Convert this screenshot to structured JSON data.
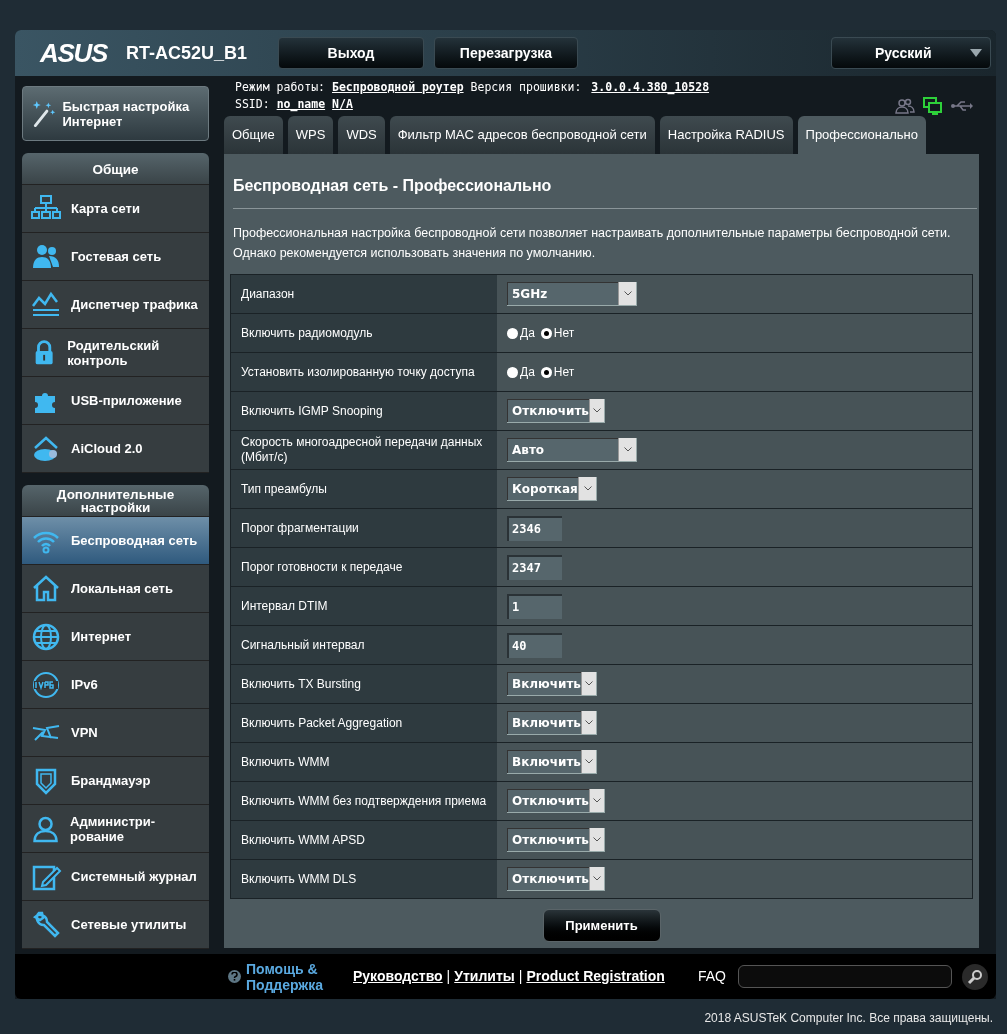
{
  "header": {
    "logo": "ASUS",
    "model": "RT-AC52U_B1",
    "buttons": [
      "Выход",
      "Перезагрузка"
    ],
    "language": "Русский"
  },
  "quick_setup": "Быстрая настройка Интернет",
  "info": {
    "mode_label": "Режим работы:",
    "mode": "Беспроводной роутер",
    "firmware_label": "Версия прошивки:",
    "firmware": "3.0.0.4.380_10528",
    "ssid_label": "SSID:",
    "ssid": [
      "no_name",
      "N/A"
    ]
  },
  "sidebar": [
    {
      "title": "Общие",
      "items": [
        {
          "label": "Карта сети",
          "selected": false
        },
        {
          "label": "Гостевая сеть",
          "selected": false
        },
        {
          "label": "Диспетчер трафика",
          "selected": false
        },
        {
          "label": "Родительский контроль",
          "selected": false
        },
        {
          "label": "USB-приложение",
          "selected": false
        },
        {
          "label": "AiCloud 2.0",
          "selected": false
        }
      ]
    },
    {
      "title": "Дополнительные настройки",
      "items": [
        {
          "label": "Беспроводная сеть",
          "selected": true
        },
        {
          "label": "Локальная сеть",
          "selected": false
        },
        {
          "label": "Интернет",
          "selected": false
        },
        {
          "label": "IPv6",
          "selected": false
        },
        {
          "label": "VPN",
          "selected": false
        },
        {
          "label": "Брандмауэр",
          "selected": false
        },
        {
          "label": "Администри-рование",
          "selected": false
        },
        {
          "label": "Системный журнал",
          "selected": false
        },
        {
          "label": "Сетевые утилиты",
          "selected": false
        }
      ]
    }
  ],
  "tabs": [
    {
      "label": "Общие",
      "selected": false
    },
    {
      "label": "WPS",
      "selected": false
    },
    {
      "label": "WDS",
      "selected": false
    },
    {
      "label": "Фильтр MAC адресов беспроводной сети",
      "selected": false
    },
    {
      "label": "Настройка RADIUS",
      "selected": false
    },
    {
      "label": "Профессионально",
      "selected": true
    }
  ],
  "page": {
    "title": "Беспроводная сеть - Профессионально",
    "description": "Профессиональная настройка беспроводной сети позволяет настраивать дополнительные параметры беспроводной сети. Однако рекомендуется использовать значения по умолчанию."
  },
  "settings": [
    {
      "label": "Диапазон",
      "kind": "select",
      "value": "5GHz"
    },
    {
      "label": "Включить радиомодуль",
      "kind": "radio",
      "options": [
        {
          "label": "Да",
          "selected": false
        },
        {
          "label": "Нет",
          "selected": true
        }
      ]
    },
    {
      "label": "Установить изолированную точку доступа",
      "kind": "radio",
      "options": [
        {
          "label": "Да",
          "selected": false
        },
        {
          "label": "Нет",
          "selected": true
        }
      ]
    },
    {
      "label": "Включить IGMP Snooping",
      "kind": "select",
      "value": "Отключить"
    },
    {
      "label": "Скорость многоадресной передачи данных (Мбит/с)",
      "kind": "select",
      "value": "Авто"
    },
    {
      "label": "Тип преамбулы",
      "kind": "select",
      "value": "Короткая"
    },
    {
      "label": "Порог фрагментации",
      "kind": "text",
      "value": "2346"
    },
    {
      "label": "Порог готовности к передаче",
      "kind": "text",
      "value": "2347"
    },
    {
      "label": "Интервал DTIM",
      "kind": "text",
      "value": "1"
    },
    {
      "label": "Сигнальный интервал",
      "kind": "text",
      "value": "40"
    },
    {
      "label": "Включить TX Bursting",
      "kind": "select",
      "value": "Включить"
    },
    {
      "label": "Включить Packet Aggregation",
      "kind": "select",
      "value": "Включить"
    },
    {
      "label": "Включить WMM",
      "kind": "select",
      "value": "Включить"
    },
    {
      "label": "Включить WMM без подтверждения приема",
      "kind": "select",
      "value": "Отключить"
    },
    {
      "label": "Включить WMM APSD",
      "kind": "select",
      "value": "Отключить"
    },
    {
      "label": "Включить WMM DLS",
      "kind": "select",
      "value": "Отключить"
    }
  ],
  "apply_button": "Применить",
  "footer": {
    "help": "Помощь & Поддержка",
    "links": [
      "Руководство",
      "Утилиты",
      "Product Registration"
    ],
    "separators": [
      "|",
      "|"
    ],
    "faq": "FAQ"
  },
  "copyright": "2018 ASUSTeK Computer Inc. Все права защищены."
}
